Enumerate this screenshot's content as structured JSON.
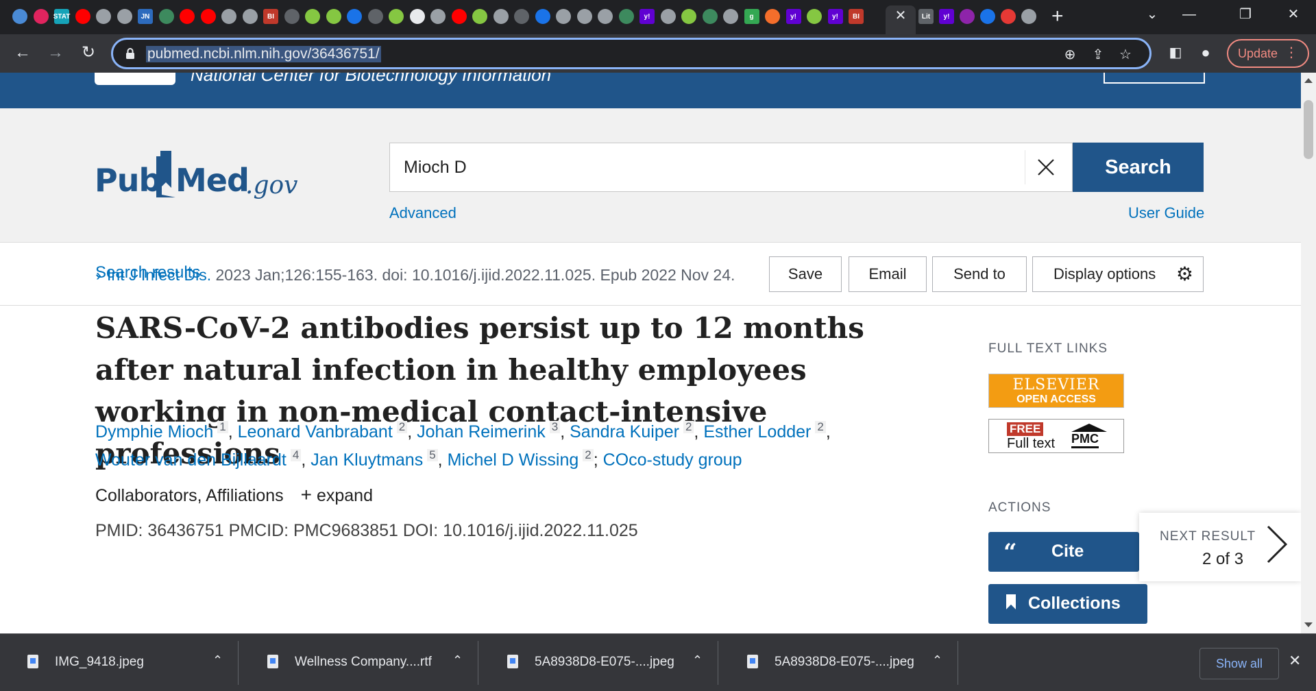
{
  "browser": {
    "url": "pubmed.ncbi.nlm.nih.gov/36436751/",
    "update_label": "Update",
    "tabs": [
      {
        "icon": "globe-icon",
        "color": "#4a8bd6"
      },
      {
        "icon": "flower-icon",
        "color": "#e0245e"
      },
      {
        "icon": "stat-icon",
        "color": "#16a3b8",
        "text": "STAT"
      },
      {
        "icon": "youtube-icon",
        "color": "#ff0000"
      },
      {
        "icon": "globe-icon",
        "color": "#9aa0a6"
      },
      {
        "icon": "globe-icon",
        "color": "#9aa0a6"
      },
      {
        "icon": "jn-icon",
        "color": "#2d6bbd",
        "text": "JN"
      },
      {
        "icon": "caduceus-icon",
        "color": "#3d8a5e"
      },
      {
        "icon": "youtube-icon",
        "color": "#ff0000"
      },
      {
        "icon": "youtube-icon",
        "color": "#ff0000"
      },
      {
        "icon": "globe-icon",
        "color": "#9aa0a6"
      },
      {
        "icon": "globe-icon",
        "color": "#9aa0a6"
      },
      {
        "icon": "bi-icon",
        "color": "#c0392b",
        "text": "BI"
      },
      {
        "icon": "play-icon",
        "color": "#5f6368"
      },
      {
        "icon": "rumble-icon",
        "color": "#85c742"
      },
      {
        "icon": "rumble-icon",
        "color": "#85c742"
      },
      {
        "icon": "heart-icon",
        "color": "#1a73e8"
      },
      {
        "icon": "play-icon",
        "color": "#5f6368"
      },
      {
        "icon": "rumble-icon",
        "color": "#85c742"
      },
      {
        "icon": "map-icon",
        "color": "#e8eaed"
      },
      {
        "icon": "globe-icon",
        "color": "#9aa0a6"
      },
      {
        "icon": "youtube-icon",
        "color": "#ff0000"
      },
      {
        "icon": "rumble-icon",
        "color": "#85c742"
      },
      {
        "icon": "globe-icon",
        "color": "#9aa0a6"
      },
      {
        "icon": "play-icon",
        "color": "#5f6368"
      },
      {
        "icon": "search-icon",
        "color": "#1a73e8"
      },
      {
        "icon": "globe-icon",
        "color": "#9aa0a6"
      },
      {
        "icon": "globe-icon",
        "color": "#9aa0a6"
      },
      {
        "icon": "globe-icon",
        "color": "#9aa0a6"
      },
      {
        "icon": "caduceus-icon",
        "color": "#3d8a5e"
      },
      {
        "icon": "yahoo-icon",
        "color": "#6001d2",
        "text": "y!"
      },
      {
        "icon": "globe-icon",
        "color": "#9aa0a6"
      },
      {
        "icon": "rumble-icon",
        "color": "#85c742"
      },
      {
        "icon": "caduceus-icon",
        "color": "#3d8a5e"
      },
      {
        "icon": "globe-icon",
        "color": "#9aa0a6"
      },
      {
        "icon": "g-icon",
        "color": "#34a853",
        "text": "g"
      },
      {
        "icon": "bookmark-icon",
        "color": "#f46e2b"
      },
      {
        "icon": "yahoo-icon",
        "color": "#6001d2",
        "text": "y!"
      },
      {
        "icon": "rumble-icon",
        "color": "#85c742"
      },
      {
        "icon": "yahoo-icon",
        "color": "#6001d2",
        "text": "y!"
      },
      {
        "icon": "bi-icon",
        "color": "#c0392b",
        "text": "BI"
      }
    ],
    "tabs_after": [
      {
        "icon": "lit-icon",
        "color": "#5f6368",
        "text": "Lit"
      },
      {
        "icon": "yahoo-icon",
        "color": "#6001d2",
        "text": "y!"
      },
      {
        "icon": "heart-icon",
        "color": "#8e24aa"
      },
      {
        "icon": "heart-icon",
        "color": "#1a73e8"
      },
      {
        "icon": "health-icon",
        "color": "#e53935"
      },
      {
        "icon": "globe-icon",
        "color": "#9aa0a6"
      }
    ]
  },
  "ncbi": {
    "banner_text": "National Center for Biotechnology Information"
  },
  "search": {
    "logo_pub": "Pub",
    "logo_med": "Med",
    "logo_gov": ".gov",
    "query": "Mioch D",
    "search_label": "Search",
    "advanced_label": "Advanced",
    "user_guide_label": "User Guide"
  },
  "actions": {
    "search_results": "Search results",
    "save": "Save",
    "email": "Email",
    "send_to": "Send to",
    "display_options": "Display options"
  },
  "article": {
    "journal": "Int J Infect Dis.",
    "citation": "2023 Jan;126:155-163. doi: 10.1016/j.ijid.2022.11.025. Epub 2022 Nov 24.",
    "title": "SARS-CoV-2 antibodies persist up to 12 months after natural infection in healthy employees working in non-medical contact-intensive professions",
    "authors": [
      {
        "name": "Dymphie Mioch",
        "aff": "1"
      },
      {
        "name": "Leonard Vanbrabant",
        "aff": "2"
      },
      {
        "name": "Johan Reimerink",
        "aff": "3"
      },
      {
        "name": "Sandra Kuiper",
        "aff": "2"
      },
      {
        "name": "Esther Lodder",
        "aff": "2"
      },
      {
        "name": "Wouter van den Bijllaardt",
        "aff": "4"
      },
      {
        "name": "Jan Kluytmans",
        "aff": "5"
      },
      {
        "name": "Michel D Wissing",
        "aff": "2"
      }
    ],
    "group": "COco-study group",
    "collaborators_label": "Collaborators, Affiliations",
    "expand_label": "expand",
    "pmid_line": "PMID: 36436751   PMCID: PMC9683851   DOI: 10.1016/j.ijid.2022.11.025"
  },
  "sidebar": {
    "full_text_links": "FULL TEXT LINKS",
    "elsevier_top": "ELSEVIER",
    "elsevier_bottom": "OPEN ACCESS",
    "pmc_free": "FREE",
    "pmc_full_text": "Full text",
    "pmc_label": "PMC",
    "actions_heading": "ACTIONS",
    "cite": "Cite",
    "collections": "Collections",
    "next_result": "NEXT RESULT",
    "next_result_pos": "2 of 3"
  },
  "downloads": {
    "items": [
      "IMG_9418.jpeg",
      "Wellness Company....rtf",
      "5A8938D8-E075-....jpeg",
      "5A8938D8-E075-....jpeg"
    ],
    "show_all": "Show all"
  },
  "colors": {
    "pubmed_blue": "#20558a",
    "link_blue": "#0071bc",
    "chrome_dark": "#202124",
    "toolbar": "#35363a"
  }
}
